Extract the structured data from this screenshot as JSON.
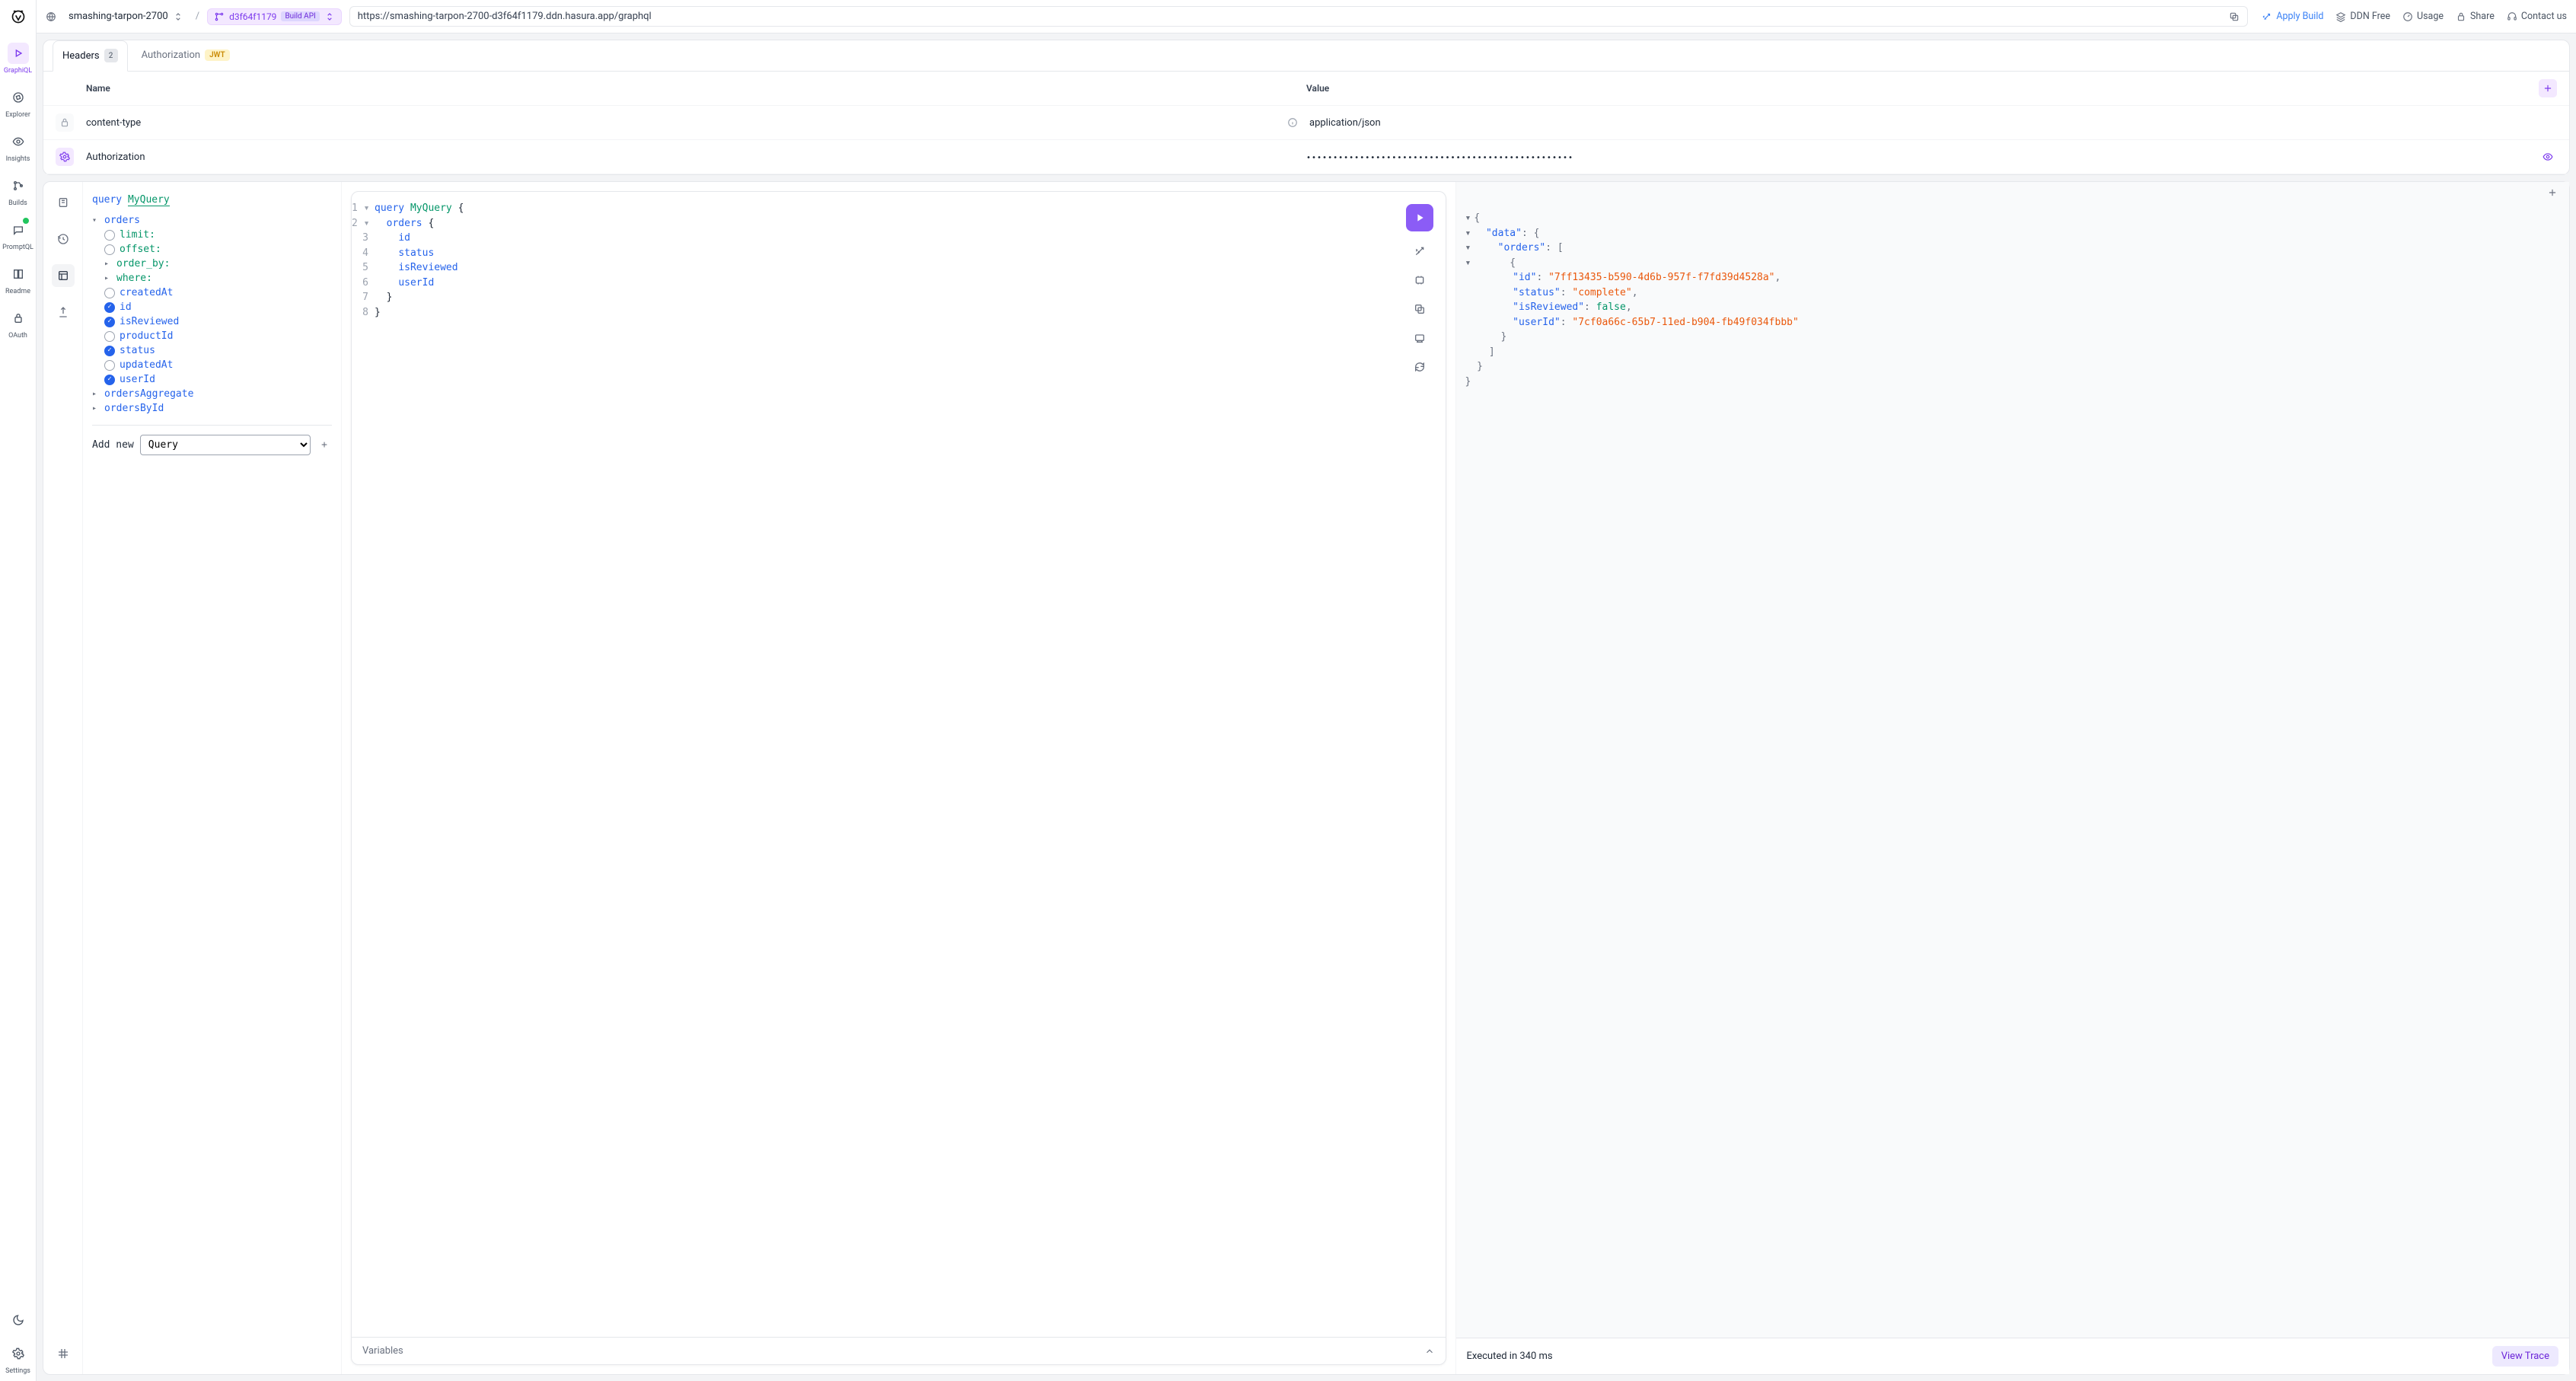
{
  "sidebar": {
    "items": [
      "GraphiQL",
      "Explorer",
      "Insights",
      "Builds",
      "PromptQL",
      "Readme",
      "OAuth"
    ]
  },
  "topbar": {
    "project": "smashing-tarpon-2700",
    "build_hash": "d3f64f1179",
    "build_api_label": "Build API",
    "url": "https://smashing-tarpon-2700-d3f64f1179.ddn.hasura.app/graphql",
    "actions": {
      "apply": "Apply Build",
      "ddn_free": "DDN Free",
      "usage": "Usage",
      "share": "Share",
      "contact": "Contact us"
    }
  },
  "tabs": {
    "headers": "Headers",
    "count": "2",
    "auth": "Authorization",
    "jwt": "JWT"
  },
  "headers": {
    "th_name": "Name",
    "th_value": "Value",
    "rows": [
      {
        "name": "content-type",
        "value": "application/json",
        "locked": true
      },
      {
        "name": "Authorization",
        "value": "••••••••••••••••••••••••••••••••••••••••••••••••••",
        "locked": false
      }
    ]
  },
  "explorer": {
    "query_kw": "query",
    "query_name": "MyQuery",
    "root": "orders",
    "args": [
      "limit:",
      "offset:",
      "order_by:",
      "where:"
    ],
    "fields": [
      {
        "name": "createdAt",
        "checked": false
      },
      {
        "name": "id",
        "checked": true
      },
      {
        "name": "isReviewed",
        "checked": true
      },
      {
        "name": "productId",
        "checked": false
      },
      {
        "name": "status",
        "checked": true
      },
      {
        "name": "updatedAt",
        "checked": false
      },
      {
        "name": "userId",
        "checked": true
      }
    ],
    "siblings": [
      "ordersAggregate",
      "ordersById"
    ],
    "add_new": "Add new",
    "add_option": "Query"
  },
  "editor": {
    "lines": [
      {
        "n": "1",
        "c": "▾",
        "t": "query MyQuery {"
      },
      {
        "n": "2",
        "c": "▾",
        "t": "  orders {"
      },
      {
        "n": "3",
        "c": "",
        "t": "    id"
      },
      {
        "n": "4",
        "c": "",
        "t": "    status"
      },
      {
        "n": "5",
        "c": "",
        "t": "    isReviewed"
      },
      {
        "n": "6",
        "c": "",
        "t": "    userId"
      },
      {
        "n": "7",
        "c": "",
        "t": "  }"
      },
      {
        "n": "8",
        "c": "",
        "t": "}"
      }
    ],
    "variables_label": "Variables"
  },
  "response": {
    "data": {
      "orders": [
        {
          "id": "7ff13435-b590-4d6b-957f-f7fd39d4528a",
          "status": "complete",
          "isReviewed": false,
          "userId": "7cf0a66c-65b7-11ed-b904-fb49f034fbbb"
        }
      ]
    },
    "footer": "Executed in 340 ms",
    "view_trace": "View Trace"
  }
}
